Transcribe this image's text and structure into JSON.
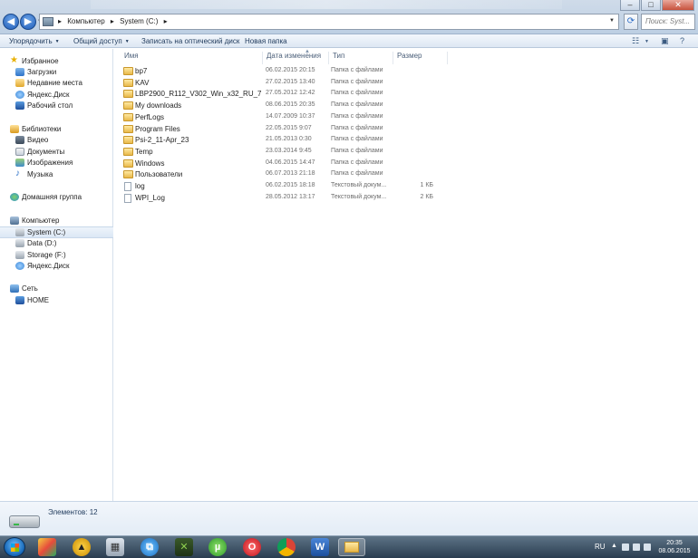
{
  "address": {
    "crumbs": [
      "Компьютер",
      "System (C:)"
    ],
    "search_placeholder": "Поиск: Syst..."
  },
  "toolbar": {
    "organize": "Упорядочить",
    "share": "Общий доступ",
    "burn": "Записать на оптический диск",
    "new_folder": "Новая папка"
  },
  "nav": {
    "favorites_header": "Избранное",
    "favorites": [
      "Загрузки",
      "Недавние места",
      "Яндекс.Диск",
      "Рабочий стол"
    ],
    "libraries_header": "Библиотеки",
    "libraries": [
      "Видео",
      "Документы",
      "Изображения",
      "Музыка"
    ],
    "homegroup": "Домашняя группа",
    "computer_header": "Компьютер",
    "drives": [
      "System (C:)",
      "Data (D:)",
      "Storage (F:)",
      "Яндекс.Диск"
    ],
    "network_header": "Сеть",
    "network_items": [
      "HOME"
    ]
  },
  "columns": {
    "name": "Имя",
    "date": "Дата изменения",
    "type": "Тип",
    "size": "Размер"
  },
  "files": [
    {
      "name": "bp7",
      "date": "06.02.2015 20:15",
      "type": "Папка с файлами",
      "size": "",
      "kind": "folder"
    },
    {
      "name": "KAV",
      "date": "27.02.2015 13:40",
      "type": "Папка с файлами",
      "size": "",
      "kind": "folder"
    },
    {
      "name": "LBP2900_R112_V302_Win_x32_RU_7",
      "date": "27.05.2012 12:42",
      "type": "Папка с файлами",
      "size": "",
      "kind": "folder"
    },
    {
      "name": "My downloads",
      "date": "08.06.2015 20:35",
      "type": "Папка с файлами",
      "size": "",
      "kind": "folder"
    },
    {
      "name": "PerfLogs",
      "date": "14.07.2009 10:37",
      "type": "Папка с файлами",
      "size": "",
      "kind": "folder"
    },
    {
      "name": "Program Files",
      "date": "22.05.2015 9:07",
      "type": "Папка с файлами",
      "size": "",
      "kind": "folder"
    },
    {
      "name": "Psi-2_11-Apr_23",
      "date": "21.05.2013 0:30",
      "type": "Папка с файлами",
      "size": "",
      "kind": "folder"
    },
    {
      "name": "Temp",
      "date": "23.03.2014 9:45",
      "type": "Папка с файлами",
      "size": "",
      "kind": "folder"
    },
    {
      "name": "Windows",
      "date": "04.06.2015 14:47",
      "type": "Папка с файлами",
      "size": "",
      "kind": "folder"
    },
    {
      "name": "Пользователи",
      "date": "06.07.2013 21:18",
      "type": "Папка с файлами",
      "size": "",
      "kind": "folder"
    },
    {
      "name": "log",
      "date": "06.02.2015 18:18",
      "type": "Текстовый докум...",
      "size": "1 КБ",
      "kind": "file"
    },
    {
      "name": "WPI_Log",
      "date": "28.05.2012 13:17",
      "type": "Текстовый докум...",
      "size": "2 КБ",
      "kind": "file"
    }
  ],
  "status": {
    "items_count": "Элементов: 12"
  },
  "taskbar": {
    "lang": "RU",
    "time": "20:35",
    "date": "08.06.2015"
  }
}
